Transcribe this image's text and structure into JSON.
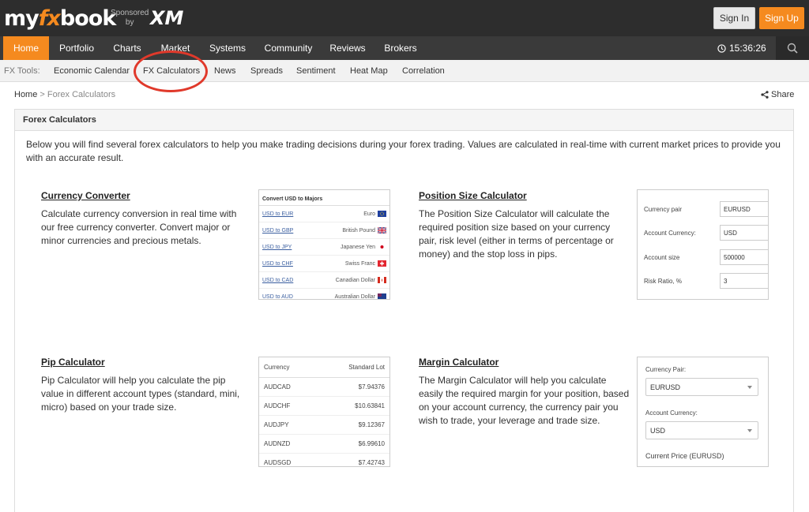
{
  "header": {
    "logo_prefix": "my",
    "logo_fx": "fx",
    "logo_suffix": "book",
    "sponsored_line1": "Sponsored",
    "sponsored_line2": "by",
    "sponsor_brand": "XM",
    "signin_label": "Sign In",
    "signup_label": "Sign Up"
  },
  "main_nav": {
    "items": [
      {
        "label": "Home",
        "active": true
      },
      {
        "label": "Portfolio"
      },
      {
        "label": "Charts"
      },
      {
        "label": "Market"
      },
      {
        "label": "Systems"
      },
      {
        "label": "Community"
      },
      {
        "label": "Reviews"
      },
      {
        "label": "Brokers"
      }
    ],
    "clock": "15:36:26",
    "clock_icon": "clock-icon",
    "search_icon": "search-icon"
  },
  "sub_nav": {
    "label": "FX Tools:",
    "items": [
      "Economic Calendar",
      "FX Calculators",
      "News",
      "Spreads",
      "Sentiment",
      "Heat Map",
      "Correlation"
    ]
  },
  "breadcrumb": {
    "home": "Home",
    "separator": ">",
    "current": "Forex Calculators"
  },
  "share_label": "Share",
  "panel": {
    "title": "Forex Calculators",
    "intro": "Below you will find several forex calculators to help you make trading decisions during your forex trading. Values are calculated in real-time with current market prices to provide you with an accurate result."
  },
  "calculators": {
    "currency_converter": {
      "title": "Currency Converter",
      "desc": "Calculate currency conversion in real time with our free currency converter. Convert major or minor currencies and precious metals.",
      "preview_title": "Convert USD to Majors",
      "rows": [
        {
          "link": "USD to EUR",
          "currency": "Euro",
          "flag": "eu"
        },
        {
          "link": "USD to GBP",
          "currency": "British Pound",
          "flag": "gb"
        },
        {
          "link": "USD to JPY",
          "currency": "Japanese Yen",
          "flag": "jp"
        },
        {
          "link": "USD to CHF",
          "currency": "Swiss Franc",
          "flag": "ch"
        },
        {
          "link": "USD to CAD",
          "currency": "Canadian Dollar",
          "flag": "ca"
        },
        {
          "link": "USD to AUD",
          "currency": "Australian Dollar",
          "flag": "au"
        }
      ]
    },
    "position_size": {
      "title": "Position Size Calculator",
      "desc": "The Position Size Calculator will calculate the required position size based on your currency pair, risk level (either in terms of percentage or money) and the stop loss in pips.",
      "fields": [
        {
          "label": "Currency pair",
          "value": "EURUSD"
        },
        {
          "label": "Account Currency:",
          "value": "USD"
        },
        {
          "label": "Account size",
          "value": "500000"
        },
        {
          "label": "Risk Ratio, %",
          "value": "3"
        }
      ]
    },
    "pip": {
      "title": "Pip Calculator",
      "desc": "Pip Calculator will help you calculate the pip value in different account types (standard, mini, micro) based on your trade size.",
      "col_currency": "Currency",
      "col_lot": "Standard Lot",
      "rows": [
        {
          "pair": "AUDCAD",
          "value": "$7.94376"
        },
        {
          "pair": "AUDCHF",
          "value": "$10.63841"
        },
        {
          "pair": "AUDJPY",
          "value": "$9.12367"
        },
        {
          "pair": "AUDNZD",
          "value": "$6.99610"
        },
        {
          "pair": "AUDSGD",
          "value": "$7.42743"
        }
      ]
    },
    "margin": {
      "title": "Margin Calculator",
      "desc": "The Margin Calculator will help you calculate easily the required margin for your position, based on your account currency, the currency pair you wish to trade, your leverage and trade size.",
      "pair_label": "Currency Pair:",
      "pair_value": "EURUSD",
      "account_label": "Account Currency:",
      "account_value": "USD",
      "price_label": "Current Price (EURUSD)"
    }
  },
  "colors": {
    "brand_orange": "#f58a1f",
    "topbar": "#2d2d2d",
    "highlight": "#e0392b"
  }
}
